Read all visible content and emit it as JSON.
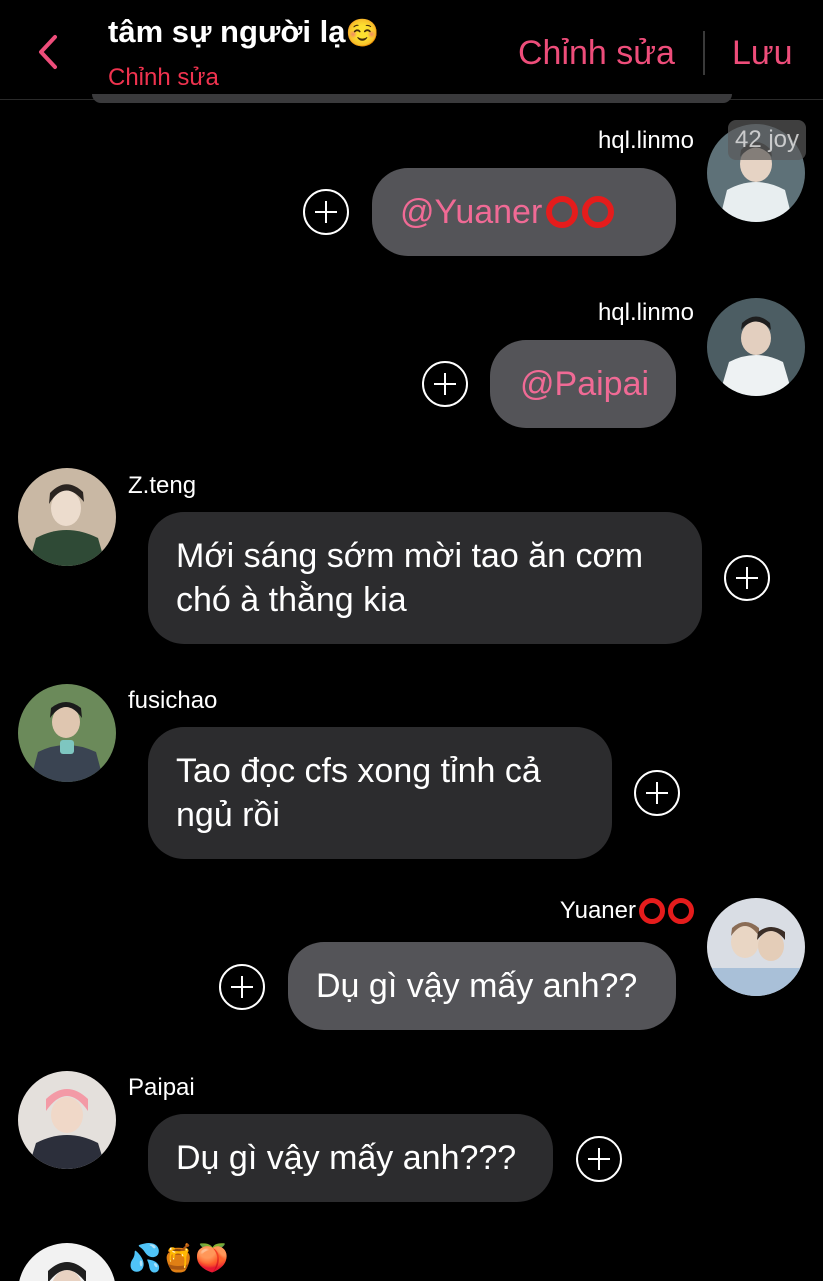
{
  "header": {
    "title": "tâm sự người lạ",
    "title_emoji": "☺️",
    "subtitle": "Chỉnh sửa",
    "edit_label": "Chỉnh sửa",
    "save_label": "Lưu"
  },
  "watermark": "42 joy",
  "messages": [
    {
      "side": "right",
      "sender": "hql.linmo",
      "text": "@Yuaner",
      "text_rings": 2,
      "mention": true
    },
    {
      "side": "right",
      "sender": "hql.linmo",
      "text": "@Paipai",
      "mention": true
    },
    {
      "side": "left",
      "sender": "Z.teng",
      "text": "Mới sáng sớm mời tao ăn cơm chó à thằng kia"
    },
    {
      "side": "left",
      "sender": "fusichao",
      "text": "Tao đọc cfs xong tỉnh cả ngủ rồi"
    },
    {
      "side": "right",
      "sender": "Yuaner",
      "sender_rings": 2,
      "text": "Dụ gì vậy mấy anh??"
    },
    {
      "side": "left",
      "sender": "Paipai",
      "text": "Dụ gì vậy mấy anh???"
    },
    {
      "side": "left",
      "sender": "💦🍯🍑",
      "text": ""
    }
  ],
  "colors": {
    "accent": "#ee4d7a",
    "subtitle": "#f0334f",
    "mention": "#f06a95",
    "ring": "#e51c1c",
    "bubble_right": "#545458",
    "bubble_left": "#2c2c2e"
  },
  "icons": {
    "back": "chevron-left-icon",
    "add": "plus-circle-icon",
    "ring": "red-circle-emoji"
  }
}
